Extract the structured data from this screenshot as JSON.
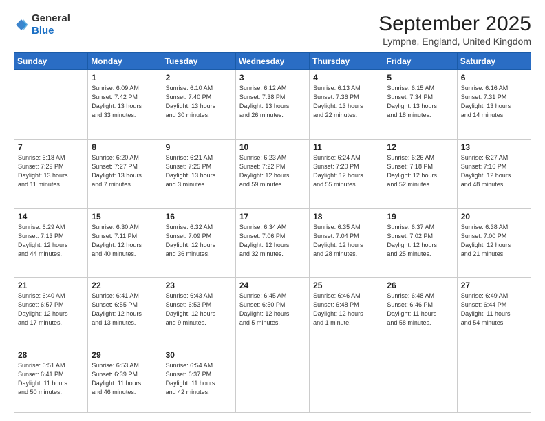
{
  "header": {
    "logo_general": "General",
    "logo_blue": "Blue",
    "month_title": "September 2025",
    "subtitle": "Lympne, England, United Kingdom"
  },
  "weekdays": [
    "Sunday",
    "Monday",
    "Tuesday",
    "Wednesday",
    "Thursday",
    "Friday",
    "Saturday"
  ],
  "weeks": [
    [
      {
        "day": "",
        "info": ""
      },
      {
        "day": "1",
        "info": "Sunrise: 6:09 AM\nSunset: 7:42 PM\nDaylight: 13 hours\nand 33 minutes."
      },
      {
        "day": "2",
        "info": "Sunrise: 6:10 AM\nSunset: 7:40 PM\nDaylight: 13 hours\nand 30 minutes."
      },
      {
        "day": "3",
        "info": "Sunrise: 6:12 AM\nSunset: 7:38 PM\nDaylight: 13 hours\nand 26 minutes."
      },
      {
        "day": "4",
        "info": "Sunrise: 6:13 AM\nSunset: 7:36 PM\nDaylight: 13 hours\nand 22 minutes."
      },
      {
        "day": "5",
        "info": "Sunrise: 6:15 AM\nSunset: 7:34 PM\nDaylight: 13 hours\nand 18 minutes."
      },
      {
        "day": "6",
        "info": "Sunrise: 6:16 AM\nSunset: 7:31 PM\nDaylight: 13 hours\nand 14 minutes."
      }
    ],
    [
      {
        "day": "7",
        "info": "Sunrise: 6:18 AM\nSunset: 7:29 PM\nDaylight: 13 hours\nand 11 minutes."
      },
      {
        "day": "8",
        "info": "Sunrise: 6:20 AM\nSunset: 7:27 PM\nDaylight: 13 hours\nand 7 minutes."
      },
      {
        "day": "9",
        "info": "Sunrise: 6:21 AM\nSunset: 7:25 PM\nDaylight: 13 hours\nand 3 minutes."
      },
      {
        "day": "10",
        "info": "Sunrise: 6:23 AM\nSunset: 7:22 PM\nDaylight: 12 hours\nand 59 minutes."
      },
      {
        "day": "11",
        "info": "Sunrise: 6:24 AM\nSunset: 7:20 PM\nDaylight: 12 hours\nand 55 minutes."
      },
      {
        "day": "12",
        "info": "Sunrise: 6:26 AM\nSunset: 7:18 PM\nDaylight: 12 hours\nand 52 minutes."
      },
      {
        "day": "13",
        "info": "Sunrise: 6:27 AM\nSunset: 7:16 PM\nDaylight: 12 hours\nand 48 minutes."
      }
    ],
    [
      {
        "day": "14",
        "info": "Sunrise: 6:29 AM\nSunset: 7:13 PM\nDaylight: 12 hours\nand 44 minutes."
      },
      {
        "day": "15",
        "info": "Sunrise: 6:30 AM\nSunset: 7:11 PM\nDaylight: 12 hours\nand 40 minutes."
      },
      {
        "day": "16",
        "info": "Sunrise: 6:32 AM\nSunset: 7:09 PM\nDaylight: 12 hours\nand 36 minutes."
      },
      {
        "day": "17",
        "info": "Sunrise: 6:34 AM\nSunset: 7:06 PM\nDaylight: 12 hours\nand 32 minutes."
      },
      {
        "day": "18",
        "info": "Sunrise: 6:35 AM\nSunset: 7:04 PM\nDaylight: 12 hours\nand 28 minutes."
      },
      {
        "day": "19",
        "info": "Sunrise: 6:37 AM\nSunset: 7:02 PM\nDaylight: 12 hours\nand 25 minutes."
      },
      {
        "day": "20",
        "info": "Sunrise: 6:38 AM\nSunset: 7:00 PM\nDaylight: 12 hours\nand 21 minutes."
      }
    ],
    [
      {
        "day": "21",
        "info": "Sunrise: 6:40 AM\nSunset: 6:57 PM\nDaylight: 12 hours\nand 17 minutes."
      },
      {
        "day": "22",
        "info": "Sunrise: 6:41 AM\nSunset: 6:55 PM\nDaylight: 12 hours\nand 13 minutes."
      },
      {
        "day": "23",
        "info": "Sunrise: 6:43 AM\nSunset: 6:53 PM\nDaylight: 12 hours\nand 9 minutes."
      },
      {
        "day": "24",
        "info": "Sunrise: 6:45 AM\nSunset: 6:50 PM\nDaylight: 12 hours\nand 5 minutes."
      },
      {
        "day": "25",
        "info": "Sunrise: 6:46 AM\nSunset: 6:48 PM\nDaylight: 12 hours\nand 1 minute."
      },
      {
        "day": "26",
        "info": "Sunrise: 6:48 AM\nSunset: 6:46 PM\nDaylight: 11 hours\nand 58 minutes."
      },
      {
        "day": "27",
        "info": "Sunrise: 6:49 AM\nSunset: 6:44 PM\nDaylight: 11 hours\nand 54 minutes."
      }
    ],
    [
      {
        "day": "28",
        "info": "Sunrise: 6:51 AM\nSunset: 6:41 PM\nDaylight: 11 hours\nand 50 minutes."
      },
      {
        "day": "29",
        "info": "Sunrise: 6:53 AM\nSunset: 6:39 PM\nDaylight: 11 hours\nand 46 minutes."
      },
      {
        "day": "30",
        "info": "Sunrise: 6:54 AM\nSunset: 6:37 PM\nDaylight: 11 hours\nand 42 minutes."
      },
      {
        "day": "",
        "info": ""
      },
      {
        "day": "",
        "info": ""
      },
      {
        "day": "",
        "info": ""
      },
      {
        "day": "",
        "info": ""
      }
    ]
  ]
}
